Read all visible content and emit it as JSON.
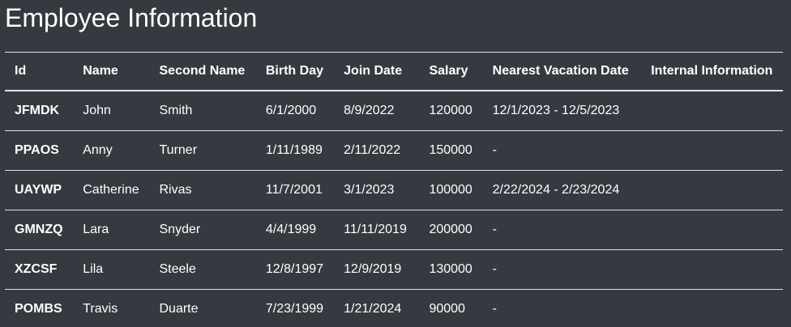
{
  "page": {
    "title": "Employee Information"
  },
  "table": {
    "headers": [
      "Id",
      "Name",
      "Second Name",
      "Birth Day",
      "Join Date",
      "Salary",
      "Nearest Vacation Date",
      "Internal Information"
    ],
    "rows": [
      [
        "JFMDK",
        "John",
        "Smith",
        "6/1/2000",
        "8/9/2022",
        "120000",
        "12/1/2023 - 12/5/2023",
        ""
      ],
      [
        "PPAOS",
        "Anny",
        "Turner",
        "1/11/1989",
        "2/11/2022",
        "150000",
        "-",
        ""
      ],
      [
        "UAYWP",
        "Catherine",
        "Rivas",
        "11/7/2001",
        "3/1/2023",
        "100000",
        "2/22/2024 - 2/23/2024",
        ""
      ],
      [
        "GMNZQ",
        "Lara",
        "Snyder",
        "4/4/1999",
        "11/11/2019",
        "200000",
        "-",
        ""
      ],
      [
        "XZCSF",
        "Lila",
        "Steele",
        "12/8/1997",
        "12/9/2019",
        "130000",
        "-",
        ""
      ],
      [
        "POMBS",
        "Travis",
        "Duarte",
        "7/23/1999",
        "1/21/2024",
        "90000",
        "-",
        ""
      ]
    ]
  }
}
